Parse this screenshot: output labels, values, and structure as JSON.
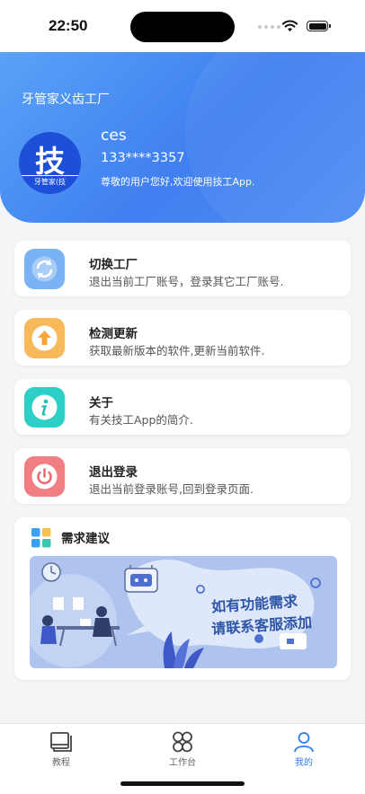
{
  "status_bar": {
    "time": "22:50"
  },
  "header": {
    "factory_name": "牙管家义齿工厂",
    "avatar_char": "技",
    "avatar_strip": "牙管家(技",
    "user_name": "ces",
    "phone": "133****3357",
    "greeting": "尊敬的用户您好,欢迎使用技工App."
  },
  "menu": [
    {
      "title": "切换工厂",
      "desc": "退出当前工厂账号，登录其它工厂账号.",
      "icon": "refresh-icon",
      "color": "#7ab3f5"
    },
    {
      "title": "检测更新",
      "desc": "获取最新版本的软件,更新当前软件.",
      "icon": "upload-arrow-icon",
      "color": "#f7b95a"
    },
    {
      "title": "关于",
      "desc": "有关技工App的简介.",
      "icon": "info-icon",
      "color": "#2ecfc7"
    },
    {
      "title": "退出登录",
      "desc": "退出当前登录账号,回到登录页面.",
      "icon": "power-icon",
      "color": "#f07e82"
    }
  ],
  "suggest": {
    "title": "需求建议",
    "banner_line1": "如有功能需求",
    "banner_line2": "请联系客服添加"
  },
  "tabs": [
    {
      "label": "教程",
      "icon": "book-icon",
      "active": false
    },
    {
      "label": "工作台",
      "icon": "grid-icon",
      "active": false
    },
    {
      "label": "我的",
      "icon": "user-icon",
      "active": true
    }
  ],
  "colors": {
    "accent": "#2f7bf5",
    "header_start": "#5aa2f7",
    "header_end": "#3f7ff0"
  }
}
